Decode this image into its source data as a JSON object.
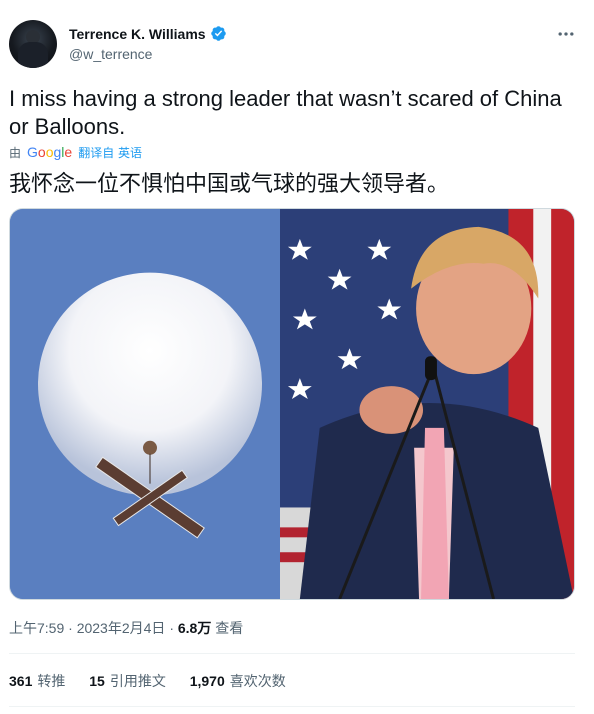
{
  "author": {
    "name": "Terrence K. Williams",
    "handle": "@w_terrence"
  },
  "tweet": {
    "text": "I miss having a strong leader that wasn’t scared of China or Balloons.",
    "translation_source_prefix": "由",
    "translation_provider_logo": "Google",
    "translation_link_label": "翻译自 英语",
    "translated_text": "我怀念一位不惧怕中国或气球的强大领导者。",
    "time": "上午7:59",
    "date": "2023年2月4日",
    "views_count": "6.8万",
    "views_label": "查看"
  },
  "stats": {
    "retweets_count": "361",
    "retweets_label": "转推",
    "quotes_count": "15",
    "quotes_label": "引用推文",
    "likes_count": "1,970",
    "likes_label": "喜欢次数"
  },
  "icons": {
    "verified": "verified-badge-icon",
    "more": "more-options-icon"
  },
  "colors": {
    "accent": "#1d9bf0",
    "secondary_text": "#536471",
    "primary_text": "#0f1419"
  }
}
